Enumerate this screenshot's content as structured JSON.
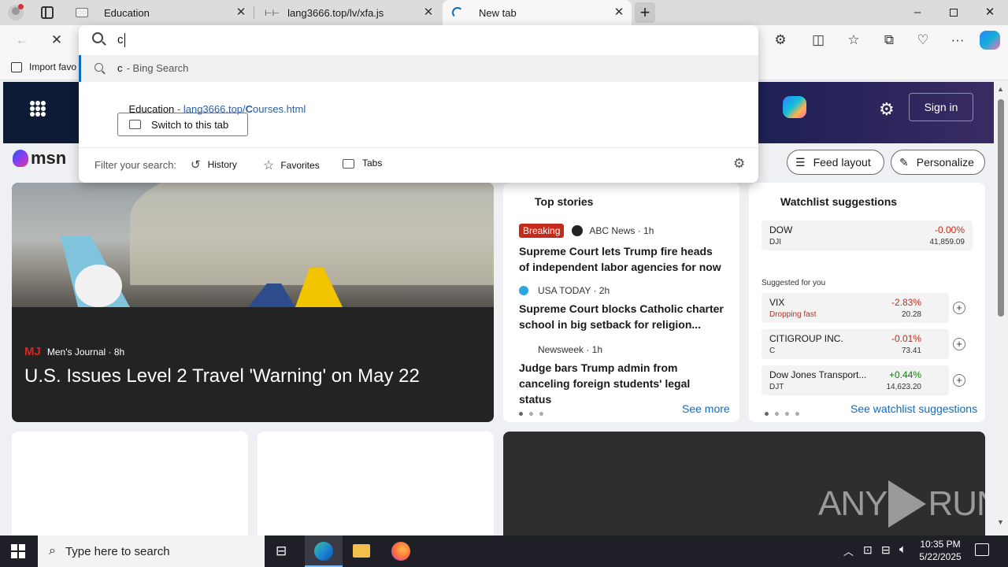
{
  "tabs": [
    {
      "title": "Education"
    },
    {
      "title": "lang3666.top/lv/xfa.js"
    },
    {
      "title": "New tab"
    }
  ],
  "favorites_bar": {
    "import_label": "Import favo"
  },
  "address_bar": {
    "value": "c"
  },
  "dropdown": {
    "suggestion_query": "c",
    "suggestion_suffix": " - Bing Search",
    "tab_match_title": "Education",
    "tab_match_sep": " - ",
    "tab_match_url_pre": "lang3666.top/",
    "tab_match_url_bold": "C",
    "tab_match_url_post": "ourses.html",
    "switch_label": "Switch to this tab",
    "filter_label": "Filter your search:",
    "filters": [
      "History",
      "Favorites",
      "Tabs"
    ]
  },
  "msn": {
    "logo": "msn",
    "sign_in": "Sign in",
    "feed_layout": "Feed layout",
    "personalize": "Personalize"
  },
  "hero_story": {
    "source_logo": "MJ",
    "source": "Men's Journal · 8h",
    "headline": "U.S. Issues Level 2 Travel 'Warning' on May 22"
  },
  "top_stories": {
    "title": "Top stories",
    "see_more": "See more",
    "items": [
      {
        "badge": "Breaking",
        "source": "ABC News · 1h",
        "headline": "Supreme Court lets Trump fire heads of independent labor agencies for now"
      },
      {
        "source": "USA TODAY · 2h",
        "headline": "Supreme Court blocks Catholic charter school in big setback for religion..."
      },
      {
        "source": "Newsweek · 1h",
        "headline": "Judge bars Trump admin from canceling foreign students' legal status"
      }
    ]
  },
  "watchlist": {
    "title": "Watchlist suggestions",
    "suggested_label": "Suggested for you",
    "see_all": "See watchlist suggestions",
    "top": {
      "name": "DOW",
      "symbol": "DJI",
      "change": "-0.00%",
      "value": "41,859.09"
    },
    "items": [
      {
        "name": "VIX",
        "sub": "Dropping fast",
        "change": "-2.83%",
        "value": "20.28"
      },
      {
        "name": "CITIGROUP INC.",
        "sub": "C",
        "change": "-0.01%",
        "value": "73.41"
      },
      {
        "name": "Dow Jones Transport...",
        "sub": "DJT",
        "change": "+0.44%",
        "value": "14,623.20"
      }
    ]
  },
  "watermark": {
    "left": "ANY",
    "right": "RUN"
  },
  "taskbar": {
    "search_placeholder": "Type here to search",
    "time": "10:35 PM",
    "date": "5/22/2025"
  },
  "colors": {
    "accent": "#0f6cbd",
    "negative": "#c42b1c",
    "positive": "#0e7a0d",
    "breaking": "#c42b1c"
  }
}
